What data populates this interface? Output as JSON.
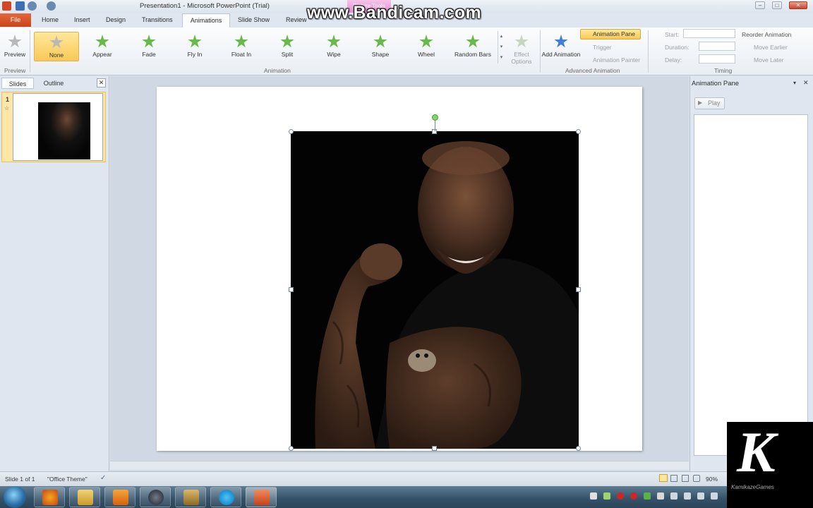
{
  "window": {
    "title": "Presentation1  -  Microsoft PowerPoint (Trial)",
    "contextual_tab": "Picture Tools"
  },
  "watermark": "www.Bandicam.com",
  "tabs": [
    "File",
    "Home",
    "Insert",
    "Design",
    "Transitions",
    "Animations",
    "Slide Show",
    "Review"
  ],
  "ribbon": {
    "preview": {
      "label": "Preview",
      "group": "Preview"
    },
    "effects": [
      "None",
      "Appear",
      "Fade",
      "Fly In",
      "Float In",
      "Split",
      "Wipe",
      "Shape",
      "Wheel",
      "Random Bars"
    ],
    "effect_options": "Effect Options",
    "animation_group": "Animation",
    "add_animation": "Add Animation",
    "animation_pane": "Animation Pane",
    "trigger": "Trigger",
    "animation_painter": "Animation Painter",
    "advanced_group": "Advanced Animation",
    "start_label": "Start:",
    "duration_label": "Duration:",
    "delay_label": "Delay:",
    "reorder": "Reorder Animation",
    "move_earlier": "Move Earlier",
    "move_later": "Move Later",
    "timing_group": "Timing"
  },
  "left_pane": {
    "tabs": [
      "Slides",
      "Outline"
    ],
    "slide_number": "1"
  },
  "right_pane": {
    "title": "Animation Pane",
    "play": "Play"
  },
  "status": {
    "slide": "Slide 1 of 1",
    "theme": "\"Office Theme\"",
    "zoom": "90%"
  },
  "logo": {
    "letter": "K",
    "sub": "KamikazeGames"
  }
}
